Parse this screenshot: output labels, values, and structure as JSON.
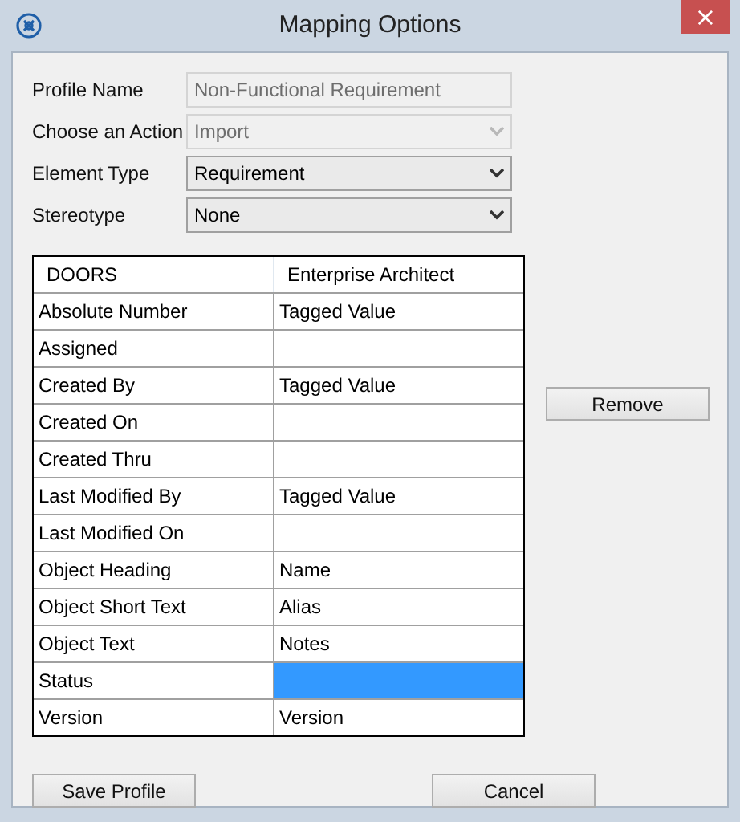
{
  "window": {
    "title": "Mapping Options",
    "close": "×"
  },
  "fields": [
    {
      "label": "Profile Name",
      "kind": "text",
      "value": "Non-Functional Requirement",
      "disabled": true
    },
    {
      "label": "Choose an Action",
      "kind": "dropdown",
      "value": "Import",
      "disabled": true
    },
    {
      "label": "Element Type",
      "kind": "dropdown",
      "value": "Requirement",
      "disabled": false
    },
    {
      "label": "Stereotype",
      "kind": "dropdown",
      "value": "None",
      "disabled": false
    }
  ],
  "table": {
    "columns": [
      "DOORS",
      "Enterprise Architect"
    ],
    "rows": [
      {
        "doors": "Absolute Number",
        "ea": "Tagged Value",
        "selected": false
      },
      {
        "doors": "Assigned",
        "selected": false
      },
      {
        "doors": "Created By",
        "ea": "Tagged Value",
        "selected": false
      },
      {
        "doors": "Created On",
        "selected": false
      },
      {
        "doors": "Created Thru",
        "selected": false
      },
      {
        "doors": "Last Modified By",
        "ea": "Tagged Value",
        "selected": false
      },
      {
        "doors": "Last Modified On",
        "selected": false
      },
      {
        "doors": "Object Heading",
        "ea": "Name",
        "selected": false
      },
      {
        "doors": "Object Short Text",
        "ea": "Alias",
        "selected": false
      },
      {
        "doors": "Object Text",
        "ea": "Notes",
        "selected": false
      },
      {
        "doors": "Status",
        "selected": true
      },
      {
        "doors": "Version",
        "ea": "Version",
        "selected": false
      }
    ]
  },
  "side_button": "Remove",
  "buttons": [
    "Save Profile",
    "Cancel"
  ]
}
